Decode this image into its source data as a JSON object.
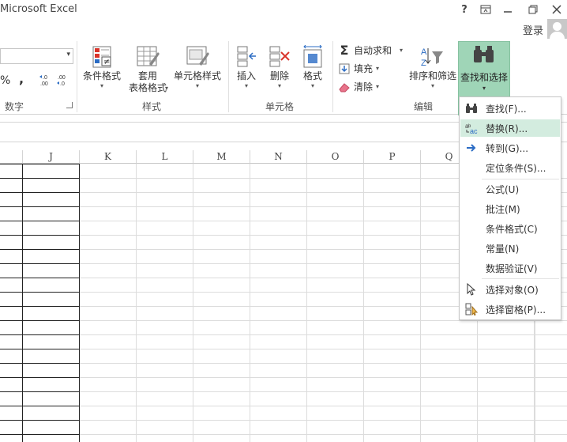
{
  "app": {
    "title": "Microsoft Excel",
    "window_buttons": [
      "?",
      "⊡",
      "—",
      "❐",
      "✕"
    ],
    "sign_in": "登录"
  },
  "ribbon": {
    "number_group": {
      "label": "数字",
      "percent": "%",
      "comma": ",",
      "increase_decimal": "←.0\n.00",
      "decrease_decimal": ".00\n→.0"
    },
    "styles_group": {
      "label": "样式",
      "conditional_format": "条件格式",
      "format_as_table_1": "套用",
      "format_as_table_2": "表格格式",
      "cell_styles": "单元格样式"
    },
    "cells_group": {
      "label": "单元格",
      "insert": "插入",
      "delete": "删除",
      "format": "格式"
    },
    "editing_group": {
      "label": "编辑",
      "autosum": "自动求和",
      "fill": "填充",
      "clear": "清除",
      "sort_filter": "排序和筛选",
      "find_select": "查找和选择"
    }
  },
  "grid": {
    "columns": [
      "J",
      "K",
      "L",
      "M",
      "N",
      "O",
      "P",
      "Q"
    ]
  },
  "find_menu": {
    "items": [
      {
        "label": "查找(F)...",
        "icon": "binoculars-icon"
      },
      {
        "label": "替换(R)...",
        "icon": "replace-icon"
      },
      {
        "label": "转到(G)...",
        "icon": "arrow-right-icon"
      },
      {
        "label": "定位条件(S)...",
        "icon": ""
      },
      {
        "label": "公式(U)",
        "icon": ""
      },
      {
        "label": "批注(M)",
        "icon": ""
      },
      {
        "label": "条件格式(C)",
        "icon": ""
      },
      {
        "label": "常量(N)",
        "icon": ""
      },
      {
        "label": "数据验证(V)",
        "icon": ""
      },
      {
        "label": "选择对象(O)",
        "icon": "cursor-icon"
      },
      {
        "label": "选择窗格(P)...",
        "icon": "selection-pane-icon"
      }
    ]
  },
  "colors": {
    "accent_green": "#9fd5b7",
    "highlight_green": "#d3ecdf",
    "red": "#d9342b",
    "blue": "#2b6cc4"
  }
}
